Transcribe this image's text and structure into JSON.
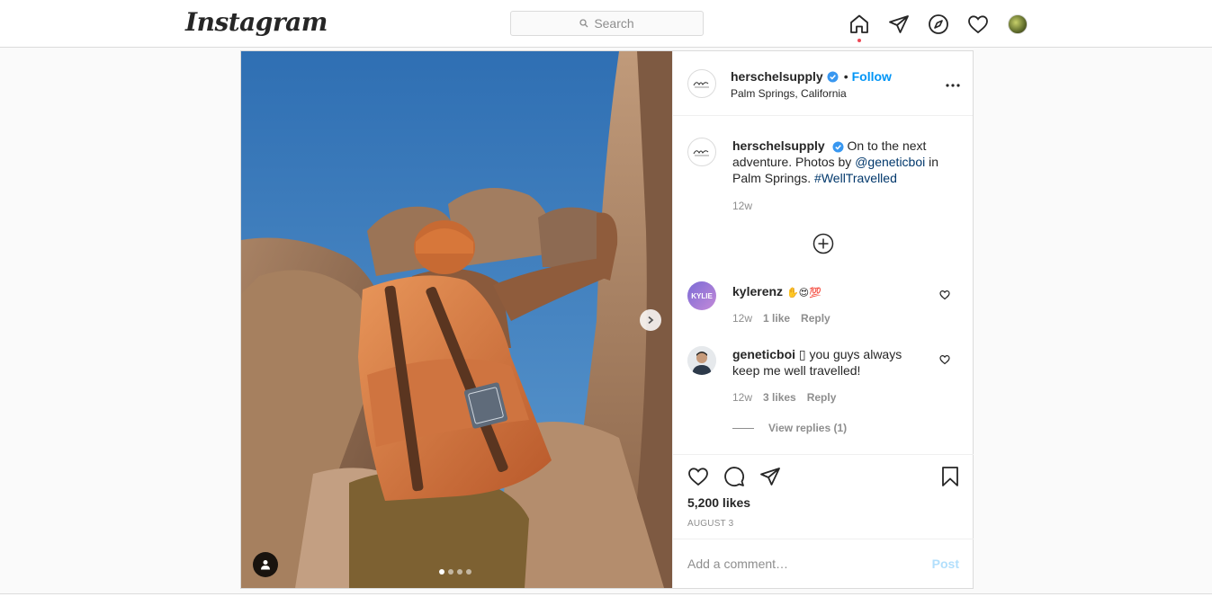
{
  "nav": {
    "logo": "Instagram",
    "search_placeholder": "Search",
    "icons": [
      "home-icon",
      "direct-icon",
      "explore-icon",
      "activity-heart-icon",
      "profile-avatar"
    ]
  },
  "post": {
    "header": {
      "username": "herschelsupply",
      "separator": "•",
      "follow_label": "Follow",
      "location": "Palm Springs, California"
    },
    "caption": {
      "username": "herschelsupply",
      "text_start": "On to the next adventure. Photos by ",
      "mention": "@geneticboi",
      "text_mid": " in Palm Springs. ",
      "hashtag": "#WellTravelled",
      "time": "12w"
    },
    "comments": [
      {
        "username": "kylerenz",
        "text": "✋😍💯",
        "avatar_text": "KYLIE",
        "time": "12w",
        "likes": "1 like",
        "reply_label": "Reply"
      },
      {
        "username": "geneticboi",
        "text": "▯ you guys always keep me well travelled!",
        "time": "12w",
        "likes": "3 likes",
        "reply_label": "Reply"
      }
    ],
    "view_replies": "View replies (1)",
    "likes": "5,200 likes",
    "date": "AUGUST 3",
    "comment_placeholder": "Add a comment…",
    "post_label": "Post",
    "carousel": {
      "total": 4,
      "active": 1
    }
  },
  "colors": {
    "accent": "#0095f6",
    "link": "#00376b",
    "notification": "#ed4956"
  }
}
